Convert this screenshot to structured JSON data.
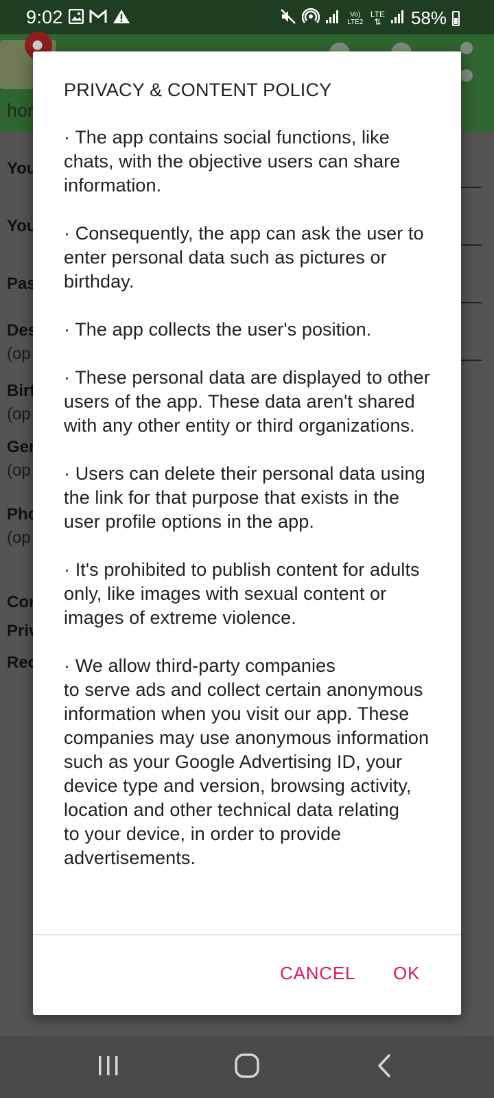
{
  "status_bar": {
    "time": "9:02",
    "battery": "58%",
    "left_icons": [
      "gallery-icon",
      "gmail-icon",
      "warning-icon"
    ],
    "right_icons": [
      "mute-icon",
      "hotspot-icon",
      "signal-icon",
      "volte-icon",
      "lte-icon",
      "signal-icon",
      "battery-icon"
    ],
    "volte_text": "Vo) LTE2",
    "lte_text": "LTE"
  },
  "background_app": {
    "header_label": "hon",
    "labels": [
      "You",
      "You",
      "Pas",
      "Des",
      "(op",
      "Birt",
      "(op",
      "Gen",
      "(op",
      "Pho",
      "(op",
      "Con",
      "Priv",
      "Rec"
    ]
  },
  "dialog": {
    "title": "PRIVACY & CONTENT POLICY",
    "paragraphs": [
      "   · The app contains social functions, like chats, with the objective users can share information.",
      "· Consequently, the app can ask the user to enter personal data such as pictures or birthday.",
      "· The app collects the user's position.",
      "· These personal data are displayed to other users of the app. These data aren't shared with any other entity or third organizations.",
      "· Users can delete their personal data using the link for that purpose that exists in the user profile options in the app.",
      "· It's prohibited to publish content for adults only, like images with sexual content or images of extreme violence.",
      "· We allow third-party companies\nto serve ads and collect certain anonymous information when you visit our app. These companies may use anonymous information such as your Google Advertising ID, your device type and version, browsing activity, location and other technical data relating\nto your device, in order to provide advertisements."
    ],
    "cancel_label": "CANCEL",
    "ok_label": "OK",
    "accent_color": "#d81b60"
  },
  "nav_bar": {
    "buttons": [
      "recents-icon",
      "home-icon",
      "back-icon"
    ]
  }
}
